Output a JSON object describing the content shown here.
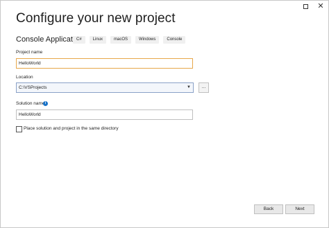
{
  "window": {
    "maximize_label": "",
    "close_label": "✕"
  },
  "header": {
    "title": "Configure your new project",
    "template_name": "Console Application",
    "tags": [
      "C#",
      "Linux",
      "macOS",
      "Windows",
      "Console"
    ]
  },
  "form": {
    "project_name_label": "Project name",
    "project_name_value": "HelloWorld",
    "location_label": "Location",
    "location_value": "C:\\VSProjects",
    "browse_label": "...",
    "solution_name_label": "Solution name",
    "solution_name_value": "HelloWorld",
    "info_icon_glyph": "i",
    "same_directory_label": "Place solution and project in the same directory",
    "same_directory_checked": false
  },
  "footer": {
    "back_label": "Back",
    "next_label": "Next"
  },
  "colors": {
    "focus_border": "#e7a74a",
    "info_icon": "#1a73c8"
  }
}
